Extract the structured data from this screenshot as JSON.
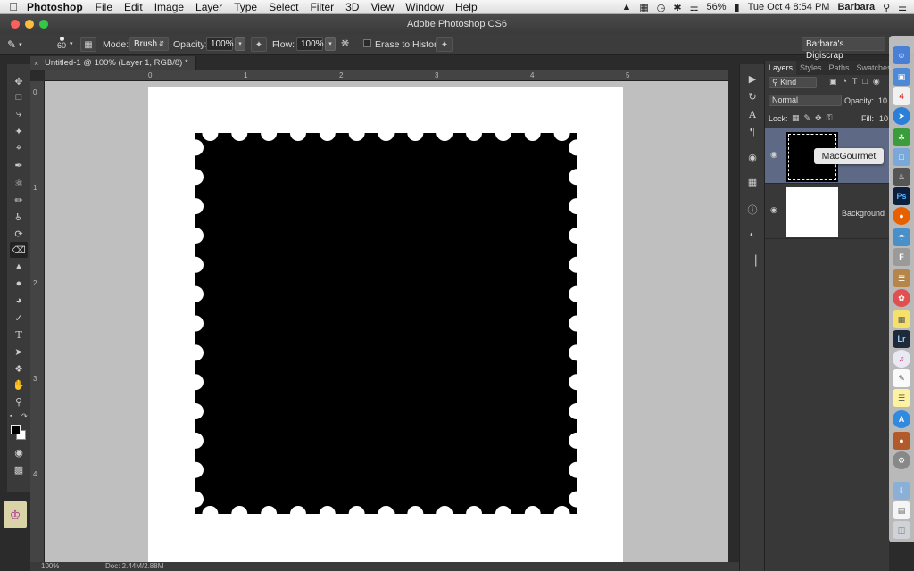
{
  "menubar": {
    "app_name": "Photoshop",
    "items": [
      "File",
      "Edit",
      "Image",
      "Layer",
      "Type",
      "Select",
      "Filter",
      "3D",
      "View",
      "Window",
      "Help"
    ],
    "battery": "56%",
    "clock": "Tue Oct 4  8:54 PM",
    "user": "Barbara"
  },
  "window": {
    "title": "Adobe Photoshop CS6"
  },
  "options_bar": {
    "brush_size": "60",
    "mode_label": "Mode:",
    "mode_value": "Brush",
    "opacity_label": "Opacity:",
    "opacity_value": "100%",
    "flow_label": "Flow:",
    "flow_value": "100%",
    "erase_history_label": "Erase to History",
    "workspace": "Barbara's Digiscrap"
  },
  "document": {
    "tab_title": "Untitled-1 @ 100% (Layer 1, RGB/8) *",
    "ruler_h": [
      "0",
      "1",
      "2",
      "3",
      "4",
      "5"
    ],
    "ruler_v": [
      "0",
      "1",
      "2",
      "3",
      "4"
    ],
    "status_zoom": "100%",
    "status_doc": "Doc: 2.44M/2.88M"
  },
  "layers_panel": {
    "tabs": [
      "Layers",
      "Styles",
      "Paths",
      "Swatches"
    ],
    "active_tab": "Layers",
    "kind_label": "Kind",
    "blend_mode": "Normal",
    "opacity_label": "Opacity:",
    "opacity_value": "10",
    "lock_label": "Lock:",
    "fill_label": "Fill:",
    "fill_value": "10",
    "layers": [
      {
        "name": "",
        "thumbnail": "black"
      },
      {
        "name": "Background",
        "thumbnail": "white"
      }
    ]
  },
  "tooltip": {
    "text": "MacGourmet"
  },
  "dock": {
    "ps_label": "Ps",
    "lr_label": "Lr"
  },
  "colors": {
    "canvas_bg": "#bfbfbf",
    "panel_bg": "#383838",
    "selected_layer": "#5e6a85",
    "stamp_fill": "#000000"
  }
}
